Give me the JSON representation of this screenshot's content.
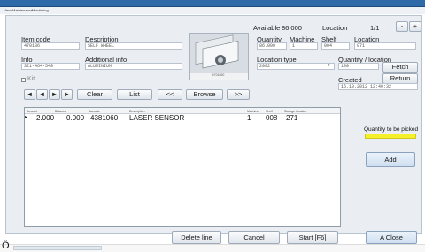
{
  "menubar": {
    "items": [
      "View",
      "Maintenance",
      "Monitoring"
    ]
  },
  "header": {
    "available_label": "Available",
    "available_value": "86.000",
    "location_label": "Location",
    "page": "1/1",
    "prev_symbol": "-",
    "next_symbol": "+"
  },
  "form": {
    "item_code_label": "Item code",
    "item_code_value": "470136",
    "description_label": "Description",
    "description_value": "SELF WHEEL",
    "info_label": "Info",
    "info_value": "321-464-549",
    "additional_info_label": "Additional info",
    "additional_info_value": "ALUMINIUM",
    "kit_label": "Kit",
    "quantity_label": "Quantity",
    "quantity_value": "86.000",
    "machine_label": "Machine",
    "machine_value": "1",
    "shelf_label": "Shelf",
    "shelf_value": "004",
    "location_label": "Location",
    "location_value": "071",
    "location_type_label": "Location type",
    "location_type_value": "2002",
    "qty_per_location_label": "Quantity / location",
    "qty_per_location_value": "100",
    "created_label": "Created",
    "created_value": "15.10.2012 12:40:32",
    "image_caption": "4701890"
  },
  "buttons": {
    "nav": [
      "◄",
      "◄",
      "►",
      "►"
    ],
    "clear": "Clear",
    "list": "List",
    "page_back": "<<",
    "browse": "Browse",
    "page_forward": ">>",
    "fetch": "Fetch",
    "return": "Return",
    "add": "Add",
    "delete_line": "Delete line",
    "cancel": "Cancel",
    "start": "Start [F6]",
    "close": "A Close"
  },
  "table": {
    "headers": [
      "Amount",
      "Balance",
      "Barcode",
      "Description",
      "Machine",
      "Shelf",
      "Storage location"
    ],
    "rows": [
      [
        "2.000",
        "0.000",
        "4381060",
        "LASER SENSOR",
        "1",
        "008",
        "271"
      ]
    ]
  },
  "side": {
    "quantity_to_pick_label": "Quantity to be picked"
  },
  "taskbar": {
    "text": "Ö"
  }
}
